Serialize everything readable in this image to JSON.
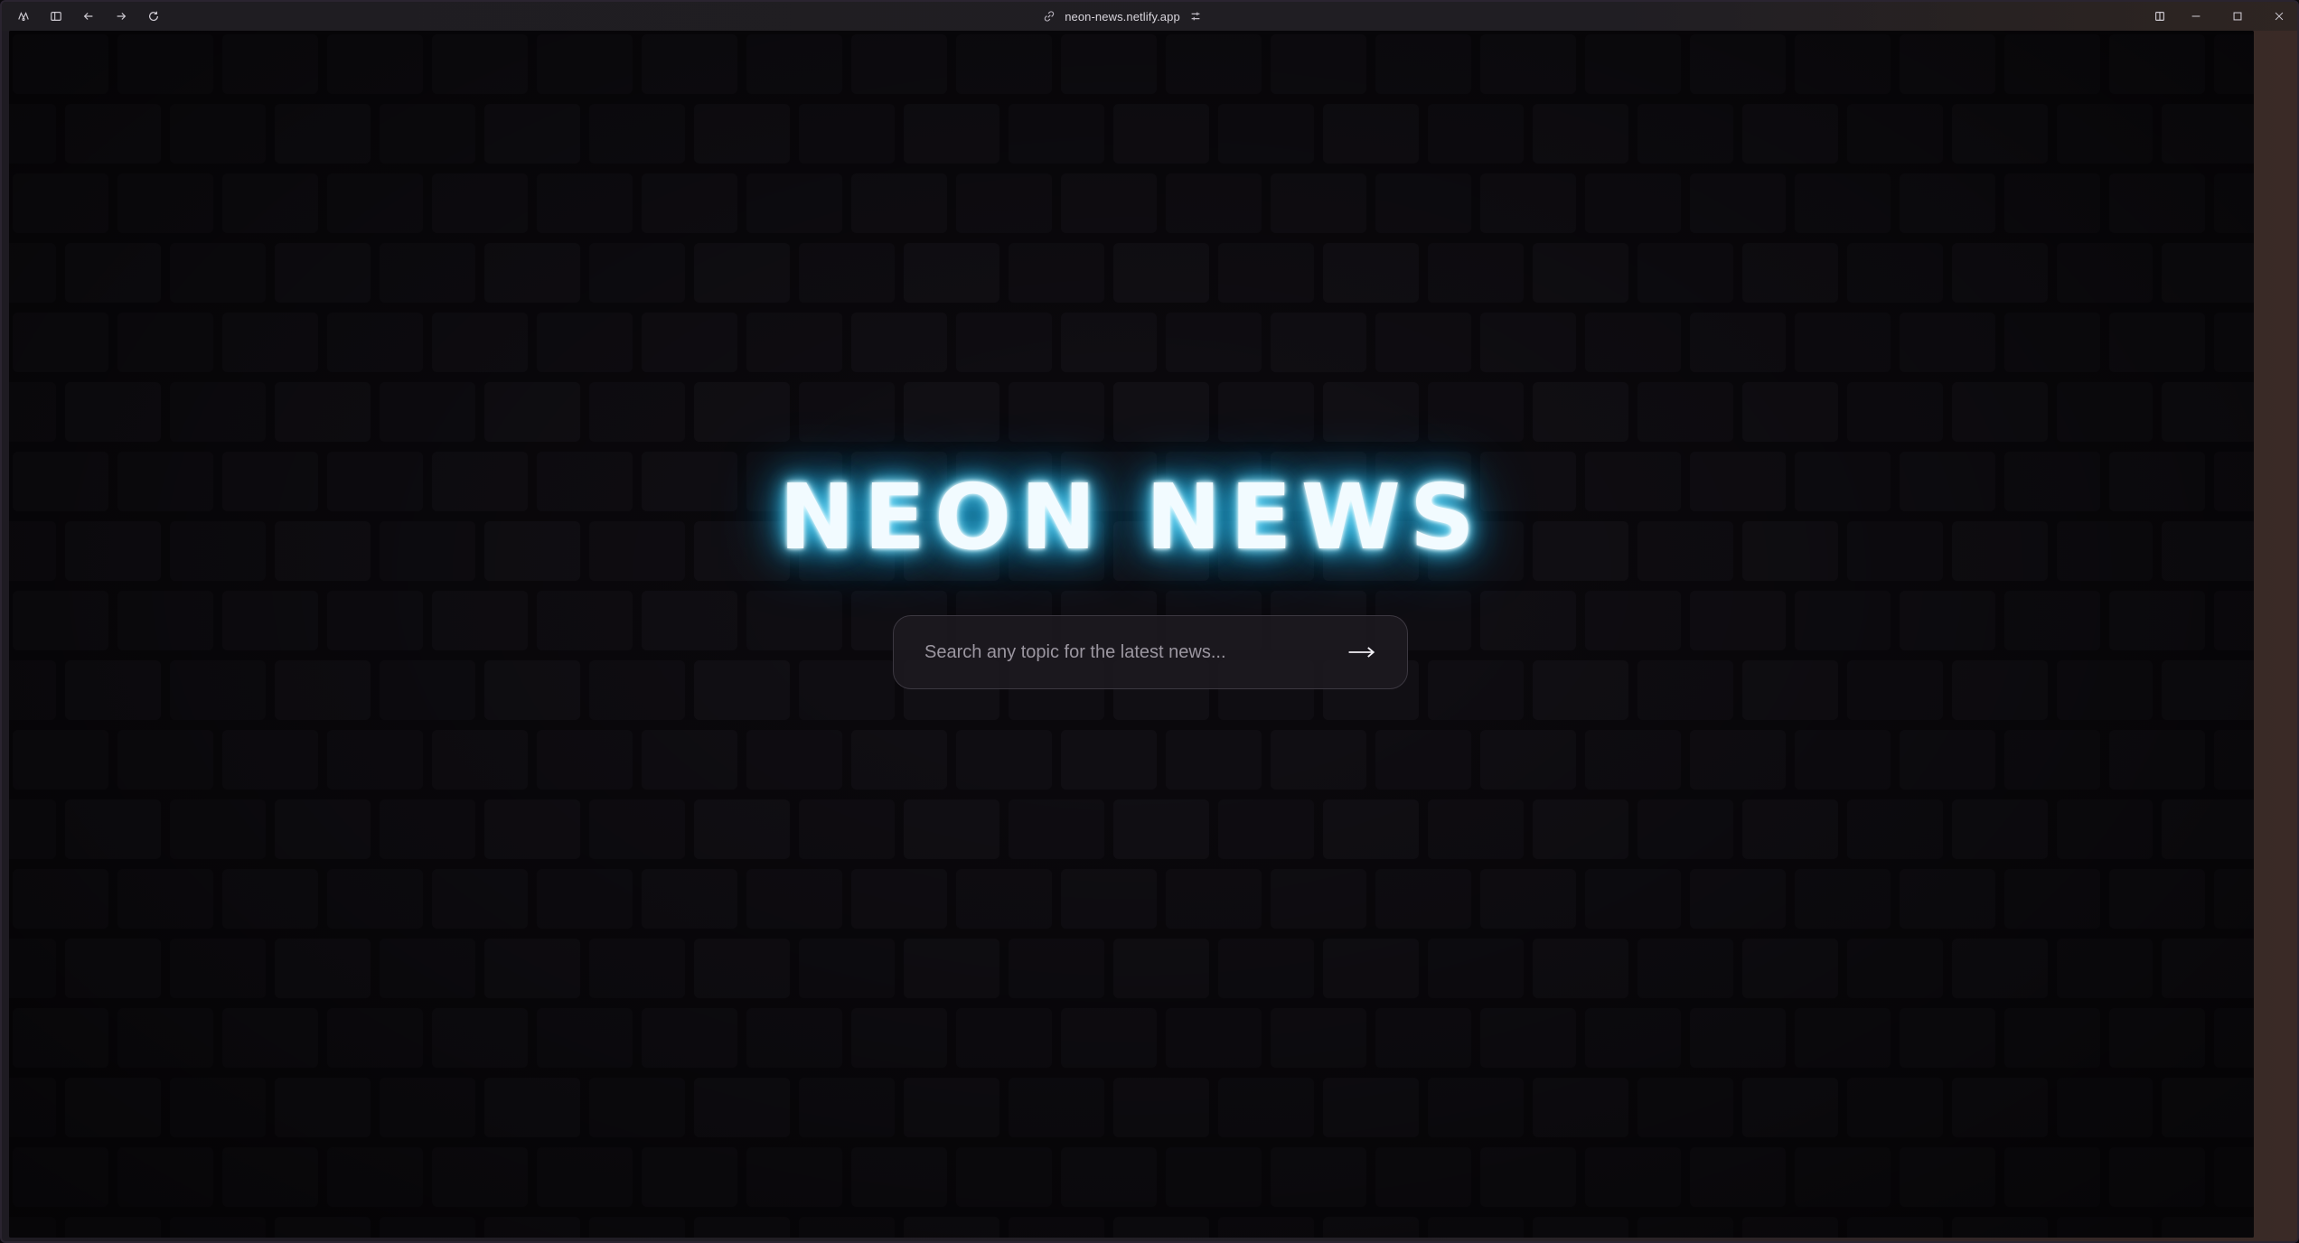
{
  "browser": {
    "url": "neon-news.netlify.app",
    "icons": [
      "extensions-icon",
      "sidebar-toggle-icon",
      "back-arrow-icon",
      "forward-arrow-icon",
      "reload-icon",
      "link-icon",
      "tune-icon",
      "split-view-icon",
      "minimize-icon",
      "maximize-icon",
      "close-icon"
    ]
  },
  "page": {
    "title": "NEON NEWS",
    "search": {
      "placeholder": "Search any topic for the latest news...",
      "value": ""
    },
    "submit_icon": "arrow-right-icon"
  },
  "colors": {
    "background": "#0a080c",
    "neon_glow": "#4fd8ff",
    "title_core": "#f2fbff",
    "search_bg": "#1c191f",
    "search_border": "#3c3841"
  }
}
